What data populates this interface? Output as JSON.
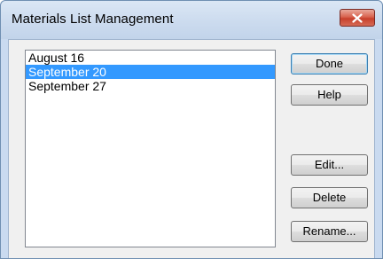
{
  "window": {
    "title": "Materials List Management"
  },
  "list": {
    "items": [
      "August 16",
      "September 20",
      "September 27"
    ],
    "selected_index": 1
  },
  "buttons": {
    "done": "Done",
    "help": "Help",
    "edit": "Edit...",
    "delete": "Delete",
    "rename": "Rename..."
  },
  "colors": {
    "selection": "#3399ff",
    "close_button": "#c8402c"
  }
}
